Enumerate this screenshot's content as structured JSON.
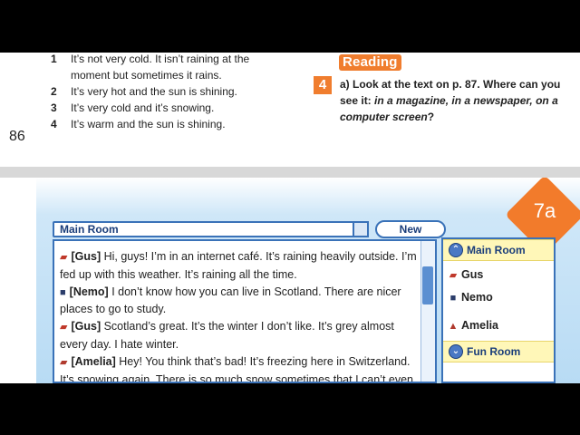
{
  "weather_list": [
    {
      "num": "1",
      "text": "It’s not very cold. It isn’t raining at the moment but sometimes it rains."
    },
    {
      "num": "2",
      "text": "It’s very hot and the sun is shining."
    },
    {
      "num": "3",
      "text": "It’s very cold and it’s snowing."
    },
    {
      "num": "4",
      "text": "It’s warm and the sun is shining."
    }
  ],
  "page_number": "86",
  "reading": {
    "tag": "Reading",
    "exercise_num": "4",
    "q_prefix": "a) Look at the text on p. 87. Where can you see it: ",
    "q_options": "in a magazine, in a newspaper, on a computer screen",
    "q_suffix": "?"
  },
  "unit_badge": "7a",
  "chat": {
    "room_title": "Main Room",
    "new_label": "New",
    "messages": [
      {
        "icon": "cap-icon",
        "nick": "[Gus]",
        "text": " Hi, guys! I’m in an internet café. It’s raining heavily outside. I’m fed up with this weather. It’s raining all the time."
      },
      {
        "icon": "robot-icon",
        "nick": "[Nemo]",
        "text": " I don’t know how you can live in Scotland. There are nicer places to go to study."
      },
      {
        "icon": "cap-icon",
        "nick": "[Gus]",
        "text": " Scotland’s great. It’s the winter I don’t like. It’s grey almost every day. I hate winter."
      },
      {
        "icon": "woman-icon",
        "nick": "[Amelia]",
        "text": " Hey! You think that’s bad! It’s freezing here in Switzerland. It’s snowing again. There is so much snow sometimes that I can’t even"
      }
    ]
  },
  "sidebar": {
    "main_room": "Main Room",
    "users": [
      {
        "icon": "cap-icon",
        "name": "Gus"
      },
      {
        "icon": "robot-icon",
        "name": "Nemo"
      },
      {
        "icon": "woman-icon",
        "name": "Amelia"
      }
    ],
    "fun_room": "Fun Room"
  }
}
